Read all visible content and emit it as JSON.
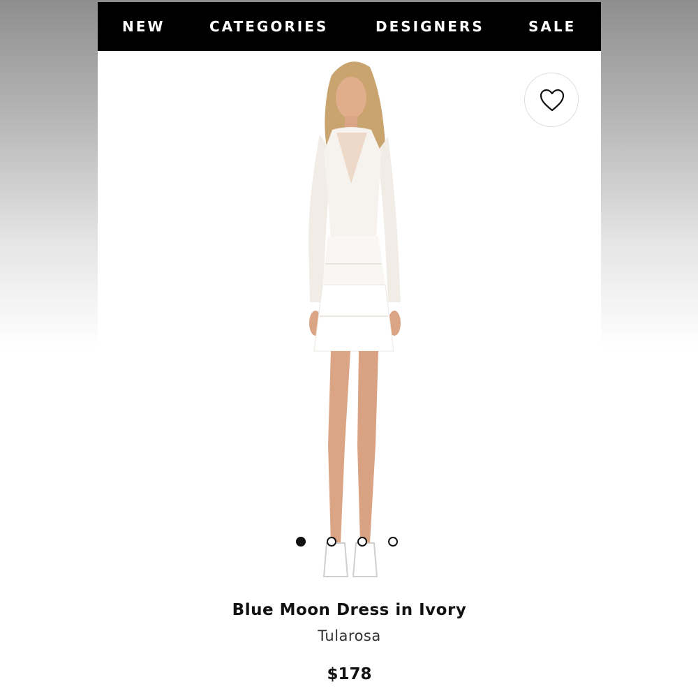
{
  "nav": {
    "items": [
      {
        "label": "NEW"
      },
      {
        "label": "CATEGORIES"
      },
      {
        "label": "DESIGNERS"
      },
      {
        "label": "SALE"
      }
    ]
  },
  "product": {
    "title": "Blue Moon Dress in Ivory",
    "brand": "Tularosa",
    "price": "$178",
    "image_icon": "dress-model-photo",
    "favorite_icon": "heart-outline-icon"
  },
  "gallery": {
    "image_count": 4,
    "active_index": 0
  },
  "colors": {
    "nav_background": "#000000",
    "nav_text": "#ffffff",
    "text_primary": "#111111"
  }
}
